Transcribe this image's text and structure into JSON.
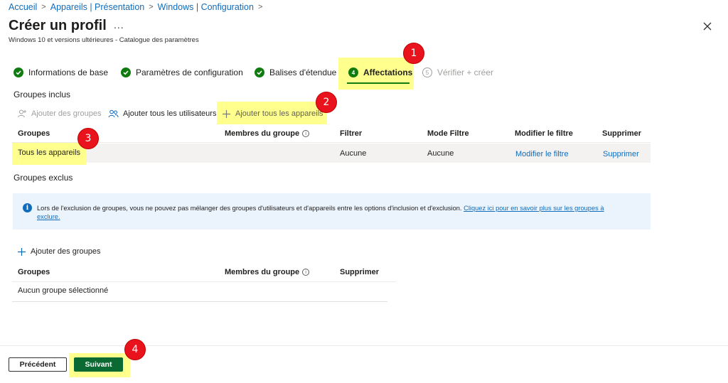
{
  "breadcrumb": {
    "items": [
      "Accueil",
      "Appareils | Présentation",
      "Windows | Configuration"
    ],
    "separator": ">"
  },
  "header": {
    "title": "Créer un profil",
    "more": "...",
    "subtitle": "Windows 10 et versions ultérieures - Catalogue des paramètres"
  },
  "tabs": [
    {
      "label": "Informations de base",
      "state": "done"
    },
    {
      "label": "Paramètres de configuration",
      "state": "done"
    },
    {
      "label": "Balises d'étendue",
      "state": "done"
    },
    {
      "label": "Affectations",
      "number": "4",
      "state": "active"
    },
    {
      "label": "Vérifier + créer",
      "number": "5",
      "state": "disabled"
    }
  ],
  "included": {
    "label": "Groupes inclus",
    "actions": {
      "add_groups": "Ajouter des groupes",
      "add_all_users": "Ajouter tous les utilisateurs",
      "add_all_devices": "Ajouter tous les appareils"
    },
    "columns": {
      "groups": "Groupes",
      "members": "Membres du groupe",
      "filter": "Filtrer",
      "filter_mode": "Mode Filtre",
      "edit_filter": "Modifier le filtre",
      "delete": "Supprimer"
    },
    "rows": [
      {
        "group": "Tous les appareils",
        "members": "",
        "filter": "Aucune",
        "filter_mode": "Aucune",
        "edit_filter": "Modifier le filtre",
        "delete": "Supprimer"
      }
    ]
  },
  "excluded": {
    "label": "Groupes exclus",
    "info_text": "Lors de l'exclusion de groupes, vous ne pouvez pas mélanger des groupes d'utilisateurs et d'appareils entre les options d'inclusion et d'exclusion.",
    "info_link_1": "Cliquez ici pour en savoir plus sur les groupes à",
    "info_link_2": "exclure.",
    "add_groups": "Ajouter des groupes",
    "columns": {
      "groups": "Groupes",
      "members": "Membres du groupe",
      "delete": "Supprimer"
    },
    "empty_text": "Aucun groupe sélectionné"
  },
  "footer": {
    "previous": "Précédent",
    "next": "Suivant"
  },
  "annotations": [
    "1",
    "2",
    "3",
    "4"
  ],
  "colors": {
    "accent_link": "#0f6cbd",
    "success_green": "#107c10",
    "primary_button": "#0b6a32",
    "highlight": "#ffff7a",
    "badge_red": "#e8131c",
    "info_bg": "#ebf3fc"
  },
  "icons": {
    "check": "checkmark-circle-icon",
    "close": "close-icon",
    "info": "info-icon",
    "add": "plus-icon",
    "users": "people-icon",
    "user": "person-add-icon"
  }
}
